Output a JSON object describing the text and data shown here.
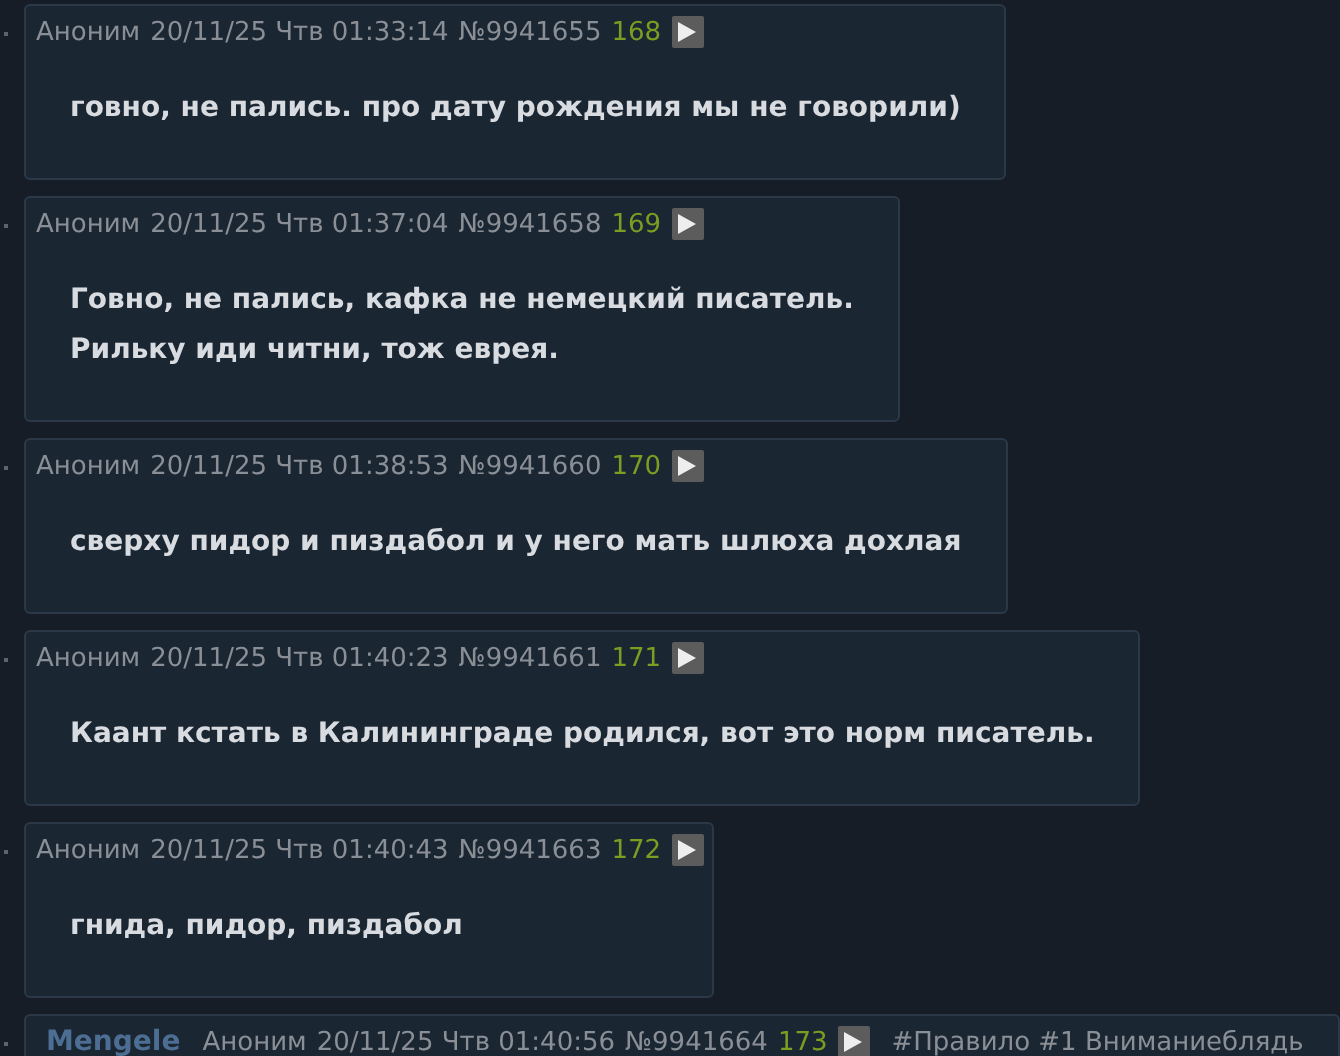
{
  "posts": [
    {
      "author": "Аноним",
      "date": "20/11/25 Чтв 01:33:14",
      "number": "№9941655",
      "index": "168",
      "lines": [
        "говно, не пались. про дату рождения мы не говорили)"
      ]
    },
    {
      "author": "Аноним",
      "date": "20/11/25 Чтв 01:37:04",
      "number": "№9941658",
      "index": "169",
      "lines": [
        "Говно, не пались, кафка не немецкий писатель.",
        "Рильку иди читни, тож еврея."
      ]
    },
    {
      "author": "Аноним",
      "date": "20/11/25 Чтв 01:38:53",
      "number": "№9941660",
      "index": "170",
      "lines": [
        "сверху пидор и пиздабол и у него мать шлюха дохлая"
      ]
    },
    {
      "author": "Аноним",
      "date": "20/11/25 Чтв 01:40:23",
      "number": "№9941661",
      "index": "171",
      "lines": [
        "Каант кстать в Калининграде родился, вот это норм писатель."
      ]
    },
    {
      "author": "Аноним",
      "date": "20/11/25 Чтв 01:40:43",
      "number": "№9941663",
      "index": "172",
      "lines": [
        "гнида, пидор, пиздабол"
      ]
    },
    {
      "subject": "Mengele",
      "author": "Аноним",
      "date": "20/11/25 Чтв 01:40:56",
      "number": "№9941664",
      "index": "173",
      "tag": "#Правило #1 Вниманиеблядь"
    }
  ]
}
